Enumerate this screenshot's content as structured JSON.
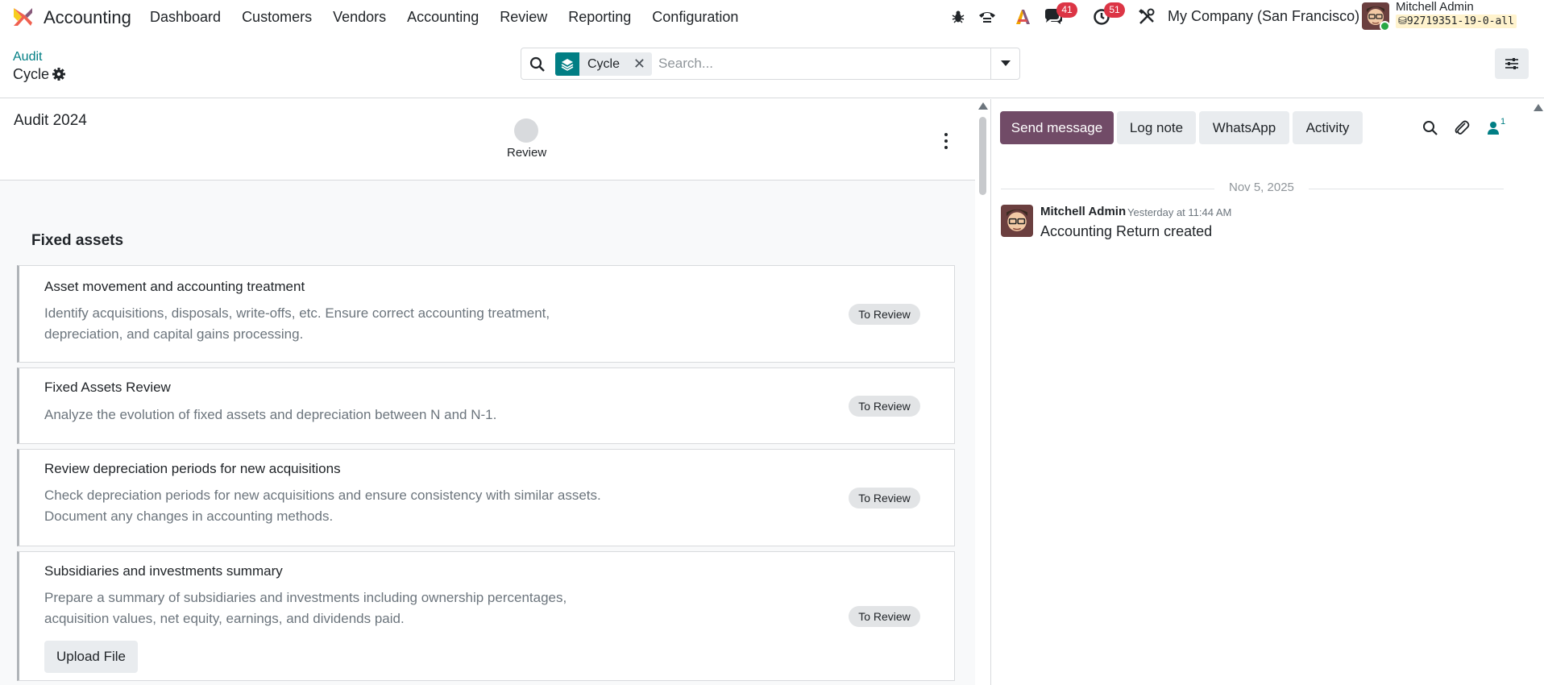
{
  "navbar": {
    "app_name": "Accounting",
    "menu": [
      "Dashboard",
      "Customers",
      "Vendors",
      "Accounting",
      "Review",
      "Reporting",
      "Configuration"
    ],
    "messages_badge": "41",
    "activities_badge": "51",
    "company": "My Company (San Francisco)",
    "user_name": "Mitchell Admin",
    "database": "92719351-19-0-all"
  },
  "control_panel": {
    "breadcrumb_parent": "Audit",
    "breadcrumb_current": "Cycle",
    "facet_label": "Cycle",
    "search_placeholder": "Search..."
  },
  "form": {
    "title": "Audit 2024",
    "stage": "Review",
    "section_title": "Fixed assets",
    "items": [
      {
        "title": "Asset movement and accounting treatment",
        "desc1": "Identify acquisitions, disposals, write-offs, etc. Ensure correct accounting treatment,",
        "desc2": "depreciation, and capital gains processing.",
        "status": "To Review"
      },
      {
        "title": "Fixed Assets Review",
        "desc1": "Analyze the evolution of fixed assets and depreciation between N and N-1.",
        "desc2": "",
        "status": "To Review"
      },
      {
        "title": "Review depreciation periods for new acquisitions",
        "desc1": "Check depreciation periods for new acquisitions and ensure consistency with similar assets.",
        "desc2": "Document any changes in accounting methods.",
        "status": "To Review"
      },
      {
        "title": "Subsidiaries and investments summary",
        "desc1": "Prepare a summary of subsidiaries and investments including ownership percentages,",
        "desc2": "acquisition values, net equity, earnings, and dividends paid.",
        "status": "To Review",
        "button": "Upload File"
      }
    ]
  },
  "chatter": {
    "send_message": "Send message",
    "log_note": "Log note",
    "whatsapp": "WhatsApp",
    "activity": "Activity",
    "followers": "1",
    "date_separator": "Nov 5, 2025",
    "message": {
      "author": "Mitchell Admin",
      "date": "Yesterday at 11:44 AM",
      "body": "Accounting Return created"
    }
  },
  "colors": {
    "brand_primary": "#714b67",
    "accent_teal": "#017e84",
    "badge_red": "#dc3545"
  }
}
